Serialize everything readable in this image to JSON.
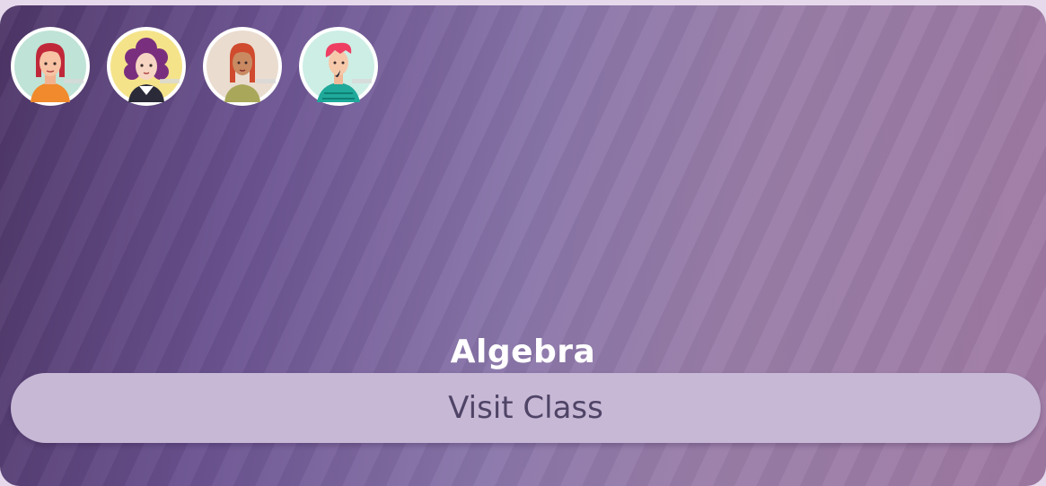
{
  "card": {
    "title": "Algebra",
    "button_label": "Visit Class"
  },
  "avatars": [
    {
      "icon": "student-avatar-red-hair-icon",
      "bg": "#bfe3d6"
    },
    {
      "icon": "student-avatar-curly-purple-hair-icon",
      "bg": "#f5e38a"
    },
    {
      "icon": "student-avatar-braids-icon",
      "bg": "#eadccf"
    },
    {
      "icon": "student-avatar-pink-hair-boy-icon",
      "bg": "#cdeee5"
    }
  ],
  "colors": {
    "gradient_start": "#4e3668",
    "gradient_end": "#a07aa3",
    "button_bg": "#c7b8d6",
    "button_text": "#4f4466"
  }
}
